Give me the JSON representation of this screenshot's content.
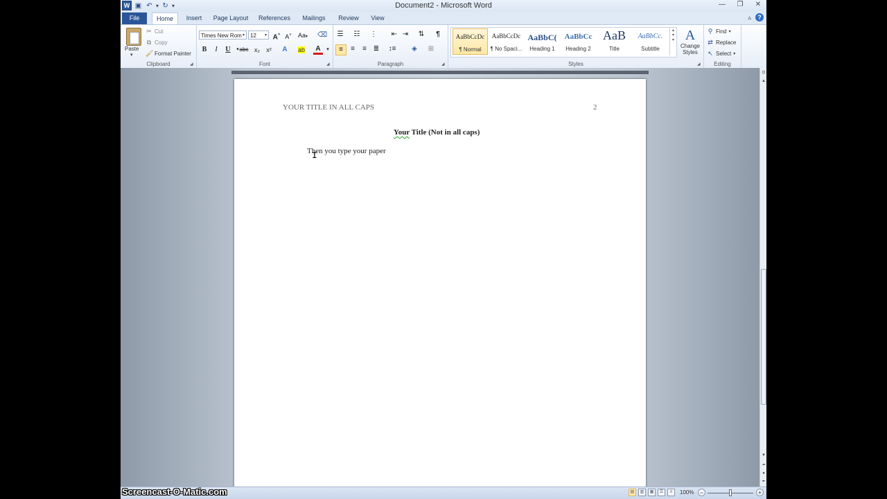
{
  "window": {
    "title": "Document2 - Microsoft Word"
  },
  "qat": {
    "word_icon": "W",
    "save_icon": "save-icon",
    "undo_icon": "undo-icon",
    "redo_icon": "redo-icon"
  },
  "tabs": [
    {
      "label": "File"
    },
    {
      "label": "Home"
    },
    {
      "label": "Insert"
    },
    {
      "label": "Page Layout"
    },
    {
      "label": "References"
    },
    {
      "label": "Mailings"
    },
    {
      "label": "Review"
    },
    {
      "label": "View"
    }
  ],
  "clipboard": {
    "group_label": "Clipboard",
    "paste_label": "Paste",
    "cut_label": "Cut",
    "copy_label": "Copy",
    "format_painter_label": "Format Painter"
  },
  "font": {
    "group_label": "Font",
    "font_name": "Times New Rom",
    "font_size": "12",
    "bold": "B",
    "italic": "I",
    "underline": "U",
    "strike": "abc",
    "subscript": "x₂",
    "superscript": "x²",
    "font_color_glyph": "A",
    "grow": "A",
    "shrink": "A",
    "change_case": "Aa"
  },
  "paragraph": {
    "group_label": "Paragraph",
    "pilcrow": "¶"
  },
  "styles": {
    "group_label": "Styles",
    "items": [
      {
        "preview": "AaBbCcDc",
        "name": "¶ Normal"
      },
      {
        "preview": "AaBbCcDc",
        "name": "¶ No Spaci..."
      },
      {
        "preview": "AaBbC(",
        "name": "Heading 1"
      },
      {
        "preview": "AaBbCc",
        "name": "Heading 2"
      },
      {
        "preview": "AaB",
        "name": "Title"
      },
      {
        "preview": "AaBbCc.",
        "name": "Subtitle"
      }
    ],
    "change_styles_label_1": "Change",
    "change_styles_label_2": "Styles",
    "change_styles_glyph": "A"
  },
  "editing": {
    "group_label": "Editing",
    "find_label": "Find",
    "replace_label": "Replace",
    "select_label": "Select"
  },
  "document": {
    "header_left": "YOUR TITLE IN ALL CAPS",
    "header_right": "2",
    "title_part1": "Your",
    "title_part2": " Title (Not in all caps)",
    "body": "Then you type your paper"
  },
  "statusbar": {
    "zoom": "100%"
  },
  "watermark": "Screencast-O-Matic.com"
}
